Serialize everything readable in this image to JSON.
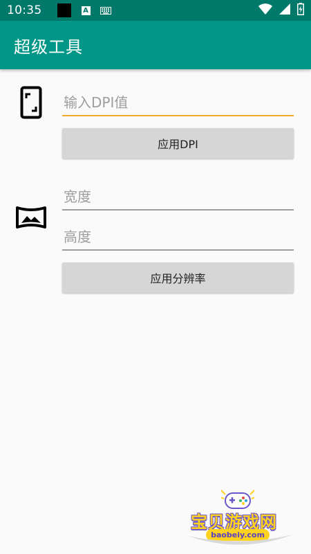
{
  "status_bar": {
    "time": "10:35",
    "icons": [
      "black-square-icon",
      "text-a-icon",
      "keyboard-icon",
      "wifi-icon",
      "signal-icon",
      "battery-charging-icon"
    ],
    "a_glyph": "A"
  },
  "app_bar": {
    "title": "超级工具",
    "background_color": "#009688",
    "status_bar_color": "#00796b"
  },
  "dpi_section": {
    "icon": "phone-icon",
    "input_placeholder": "输入DPI值",
    "input_value": "",
    "button_label": "应用DPI",
    "focus_underline_color": "#f4a62a"
  },
  "resolution_section": {
    "icon": "panorama-icon",
    "width_placeholder": "宽度",
    "width_value": "",
    "height_placeholder": "高度",
    "height_value": "",
    "button_label": "应用分辨率"
  },
  "watermark": {
    "title": "宝贝游戏网",
    "url": "baobeiy.com"
  }
}
